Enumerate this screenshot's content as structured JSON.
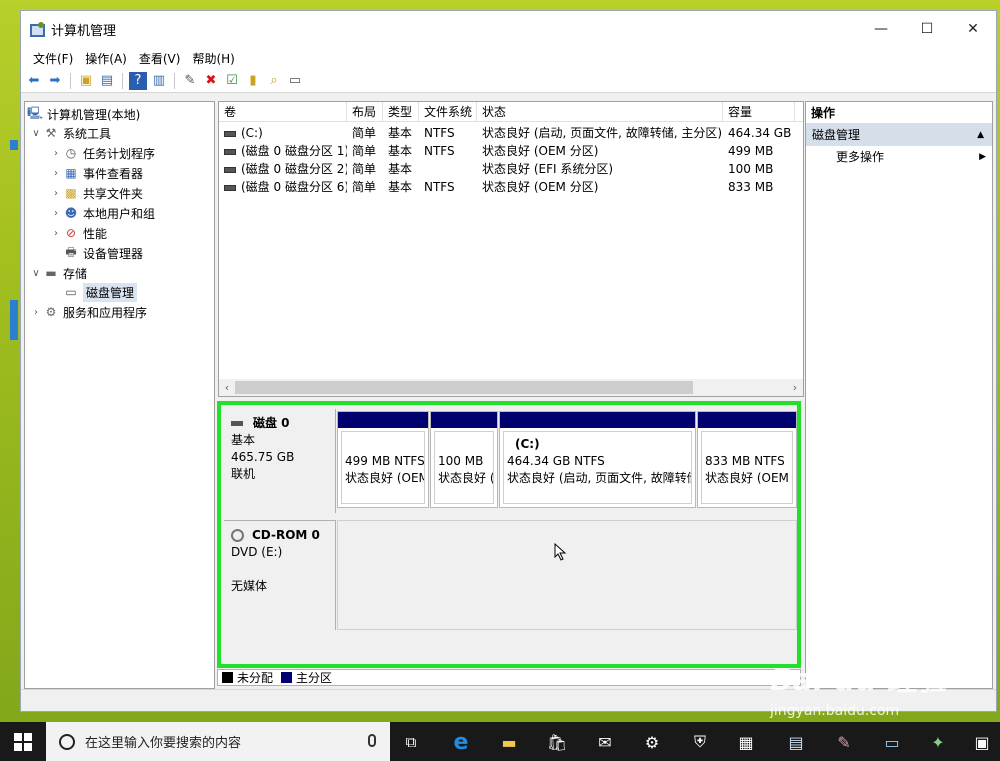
{
  "window": {
    "title": "计算机管理"
  },
  "menu": [
    "文件(F)",
    "操作(A)",
    "查看(V)",
    "帮助(H)"
  ],
  "tree": {
    "root": "计算机管理(本地)",
    "system_tools": "系统工具",
    "task_scheduler": "任务计划程序",
    "event_viewer": "事件查看器",
    "shared_folders": "共享文件夹",
    "local_users": "本地用户和组",
    "performance": "性能",
    "device_manager": "设备管理器",
    "storage": "存储",
    "disk_management": "磁盘管理",
    "services_apps": "服务和应用程序"
  },
  "volume_list": {
    "headers": [
      "卷",
      "布局",
      "类型",
      "文件系统",
      "状态",
      "容量"
    ],
    "rows": [
      [
        "(C:)",
        "简单",
        "基本",
        "NTFS",
        "状态良好 (启动, 页面文件, 故障转储, 主分区)",
        "464.34 GB"
      ],
      [
        "(磁盘 0 磁盘分区 1)",
        "简单",
        "基本",
        "NTFS",
        "状态良好 (OEM 分区)",
        "499 MB"
      ],
      [
        "(磁盘 0 磁盘分区 2)",
        "简单",
        "基本",
        "",
        "状态良好 (EFI 系统分区)",
        "100 MB"
      ],
      [
        "(磁盘 0 磁盘分区 6)",
        "简单",
        "基本",
        "NTFS",
        "状态良好 (OEM 分区)",
        "833 MB"
      ]
    ]
  },
  "disk0": {
    "name": "磁盘 0",
    "type": "基本",
    "size": "465.75 GB",
    "status": "联机",
    "partitions": [
      {
        "label": "",
        "size": "499 MB NTFS",
        "status": "状态良好 (OEM"
      },
      {
        "label": "",
        "size": "100 MB",
        "status": "状态良好 ("
      },
      {
        "label": "(C:)",
        "size": "464.34 GB NTFS",
        "status": "状态良好 (启动, 页面文件, 故障转储"
      },
      {
        "label": "",
        "size": "833 MB NTFS",
        "status": "状态良好 (OEM"
      }
    ]
  },
  "cdrom": {
    "name": "CD-ROM 0",
    "drive": "DVD (E:)",
    "media": "无媒体"
  },
  "legend": {
    "unallocated": "未分配",
    "primary": "主分区"
  },
  "actions": {
    "header": "操作",
    "section": "磁盘管理",
    "more": "更多操作"
  },
  "taskbar": {
    "search_placeholder": "在这里输入你要搜索的内容"
  },
  "watermark": {
    "brand": "Bai du 经验",
    "url": "jingyan.baidu.com"
  },
  "colors": {
    "highlight": "#22e02a",
    "primary_partition": "#00006e",
    "unallocated": "#000000"
  }
}
